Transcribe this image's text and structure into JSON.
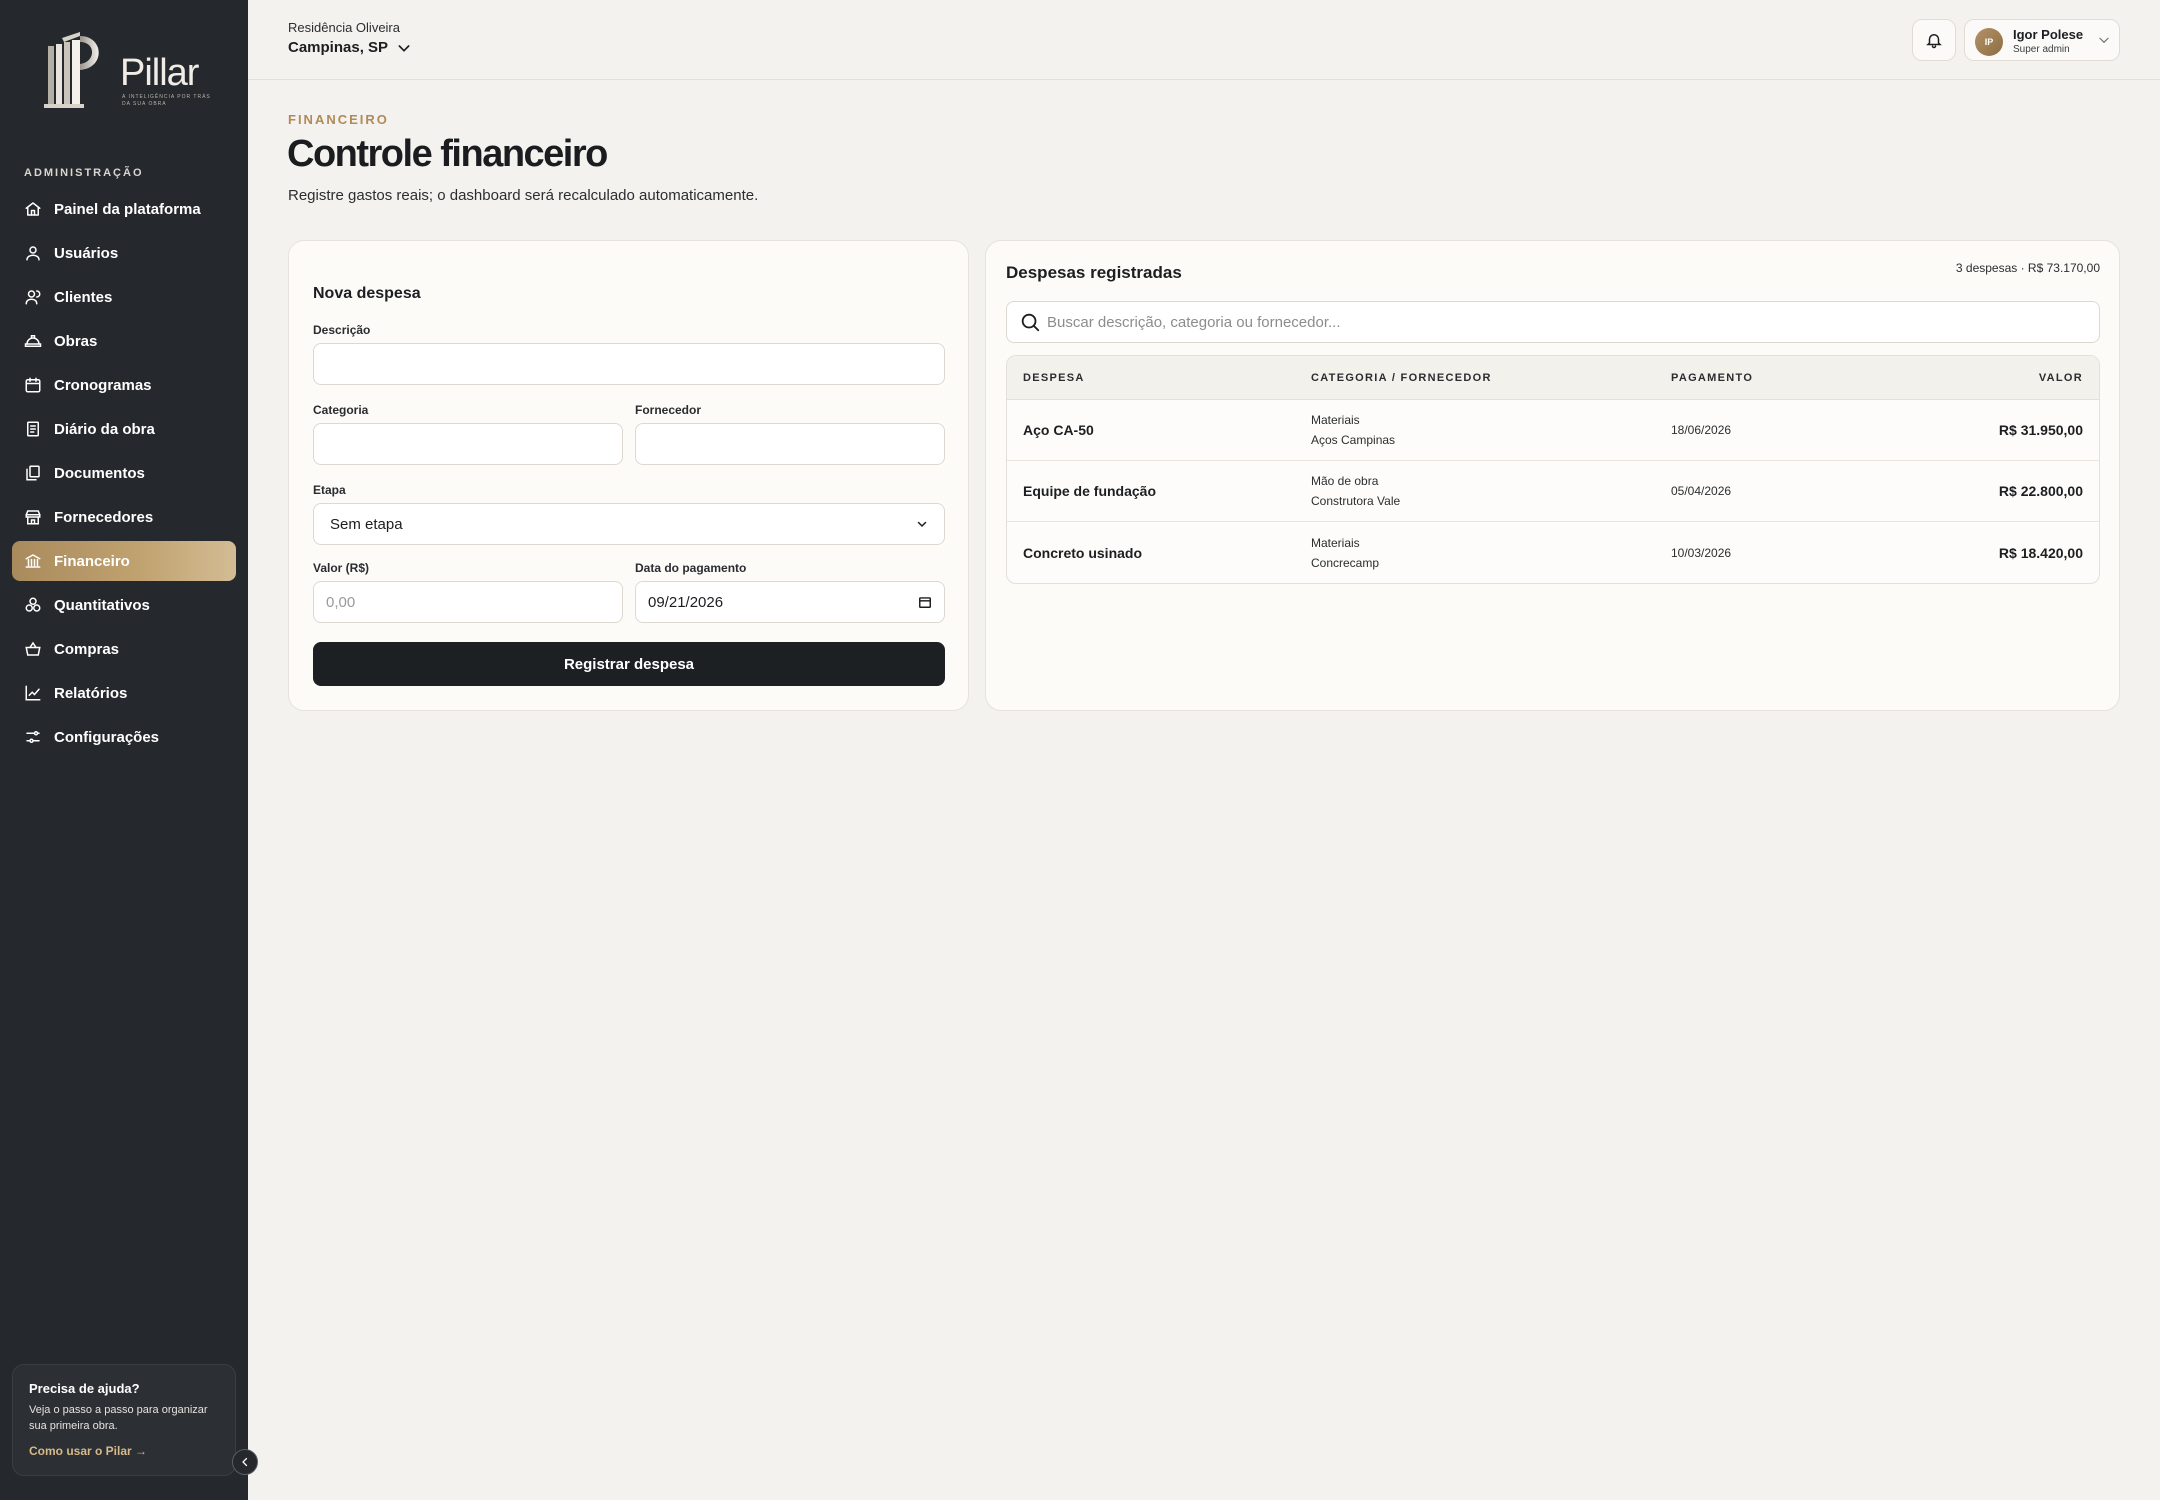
{
  "sidebar": {
    "logo": {
      "word": "Pillar",
      "tagline": "A INTELIGÊNCIA POR TRÁS DA SUA OBRA"
    },
    "section_label": "ADMINISTRAÇÃO",
    "items": [
      {
        "label": "Painel da plataforma",
        "icon": "home-icon"
      },
      {
        "label": "Usuários",
        "icon": "user-icon"
      },
      {
        "label": "Clientes",
        "icon": "client-icon"
      },
      {
        "label": "Obras",
        "icon": "helmet-icon"
      },
      {
        "label": "Cronogramas",
        "icon": "calendar-icon"
      },
      {
        "label": "Diário da obra",
        "icon": "notebook-icon"
      },
      {
        "label": "Documentos",
        "icon": "documents-icon"
      },
      {
        "label": "Fornecedores",
        "icon": "store-icon"
      },
      {
        "label": "Financeiro",
        "icon": "bank-icon",
        "active": true
      },
      {
        "label": "Quantitativos",
        "icon": "blocks-icon"
      },
      {
        "label": "Compras",
        "icon": "basket-icon"
      },
      {
        "label": "Relatórios",
        "icon": "chart-icon"
      },
      {
        "label": "Configurações",
        "icon": "settings-icon"
      }
    ],
    "help": {
      "title": "Precisa de ajuda?",
      "text": "Veja o passo a passo para organizar sua primeira obra.",
      "link": "Como usar o Pilar →"
    }
  },
  "topbar": {
    "site_name": "Residência Oliveira",
    "site_city": "Campinas, SP",
    "user": {
      "initials": "IP",
      "name": "Igor Polese",
      "role": "Super admin"
    }
  },
  "page": {
    "eyebrow": "FINANCEIRO",
    "title": "Controle financeiro",
    "subtitle": "Registre gastos reais; o dashboard será recalculado automaticamente."
  },
  "form": {
    "title": "Nova despesa",
    "descricao_label": "Descrição",
    "descricao_value": "",
    "categoria_label": "Categoria",
    "categoria_value": "",
    "fornecedor_label": "Fornecedor",
    "fornecedor_value": "",
    "etapa_label": "Etapa",
    "etapa_value": "Sem etapa",
    "valor_label": "Valor (R$)",
    "valor_placeholder": "0,00",
    "data_label": "Data do pagamento",
    "data_value": "09/21/2026",
    "submit_label": "Registrar despesa"
  },
  "list": {
    "title": "Despesas registradas",
    "summary": "3 despesas · R$ 73.170,00",
    "search_placeholder": "Buscar descrição, categoria ou fornecedor...",
    "columns": [
      "DESPESA",
      "CATEGORIA / FORNECEDOR",
      "PAGAMENTO",
      "VALOR"
    ],
    "rows": [
      {
        "name": "Aço CA-50",
        "category": "Materiais",
        "supplier": "Aços Campinas",
        "date": "18/06/2026",
        "value": "R$ 31.950,00"
      },
      {
        "name": "Equipe de fundação",
        "category": "Mão de obra",
        "supplier": "Construtora Vale",
        "date": "05/04/2026",
        "value": "R$ 22.800,00"
      },
      {
        "name": "Concreto usinado",
        "category": "Materiais",
        "supplier": "Concrecamp",
        "date": "10/03/2026",
        "value": "R$ 18.420,00"
      }
    ]
  },
  "colors": {
    "sidebar_bg": "#25282c",
    "accent": "#b08a58",
    "primary_button": "#1d2023",
    "page_bg": "#f4f2ee"
  }
}
